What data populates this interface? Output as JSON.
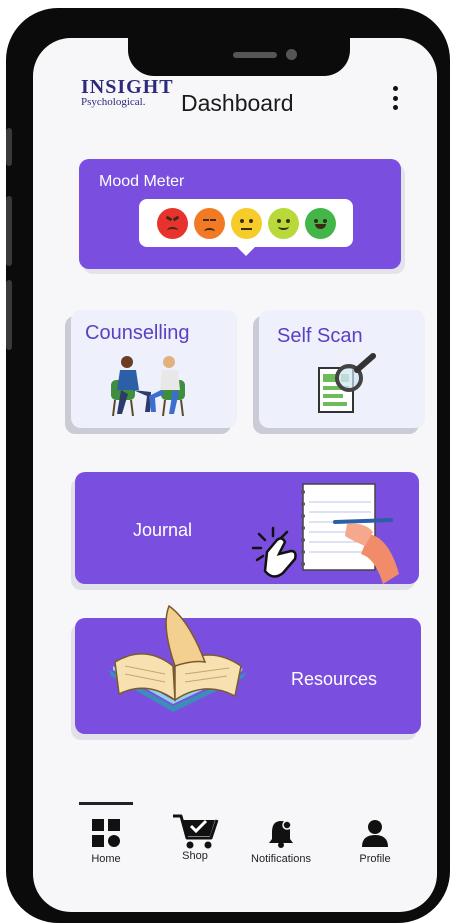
{
  "header": {
    "logo_title": "INSIGHT",
    "logo_subtitle": "Psychological.",
    "title": "Dashboard",
    "menu_icon": "more-vertical-icon"
  },
  "mood_meter": {
    "title": "Mood Meter",
    "faces": [
      {
        "name": "angry",
        "color": "#e8322e"
      },
      {
        "name": "annoyed",
        "color": "#f27a25"
      },
      {
        "name": "neutral",
        "color": "#f6cc2a"
      },
      {
        "name": "content",
        "color": "#b9d93b"
      },
      {
        "name": "happy",
        "color": "#43b649"
      }
    ]
  },
  "tiles": {
    "counselling": {
      "label": "Counselling",
      "icon": "counselling-illustration"
    },
    "self_scan": {
      "label": "Self Scan",
      "icon": "scan-document-icon"
    }
  },
  "bands": {
    "journal": {
      "label": "Journal",
      "icon": "journal-writing-illustration"
    },
    "resources": {
      "label": "Resources",
      "icon": "open-book-illustration"
    }
  },
  "nav": {
    "home": {
      "label": "Home",
      "icon": "home-grid-icon"
    },
    "shop": {
      "label": "Shop",
      "icon": "shopping-cart-icon"
    },
    "notifications": {
      "label": "Notifications",
      "icon": "bell-icon"
    },
    "profile": {
      "label": "Profile",
      "icon": "user-icon"
    }
  },
  "colors": {
    "accent": "#7a4fe0",
    "tile_background": "#eef0fb",
    "tile_text": "#5b3fc4",
    "brand": "#2c2a7a"
  }
}
